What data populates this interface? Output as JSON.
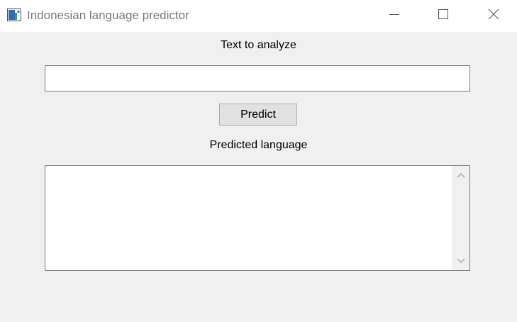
{
  "window": {
    "title": "Indonesian language predictor"
  },
  "icons": {
    "app": "app-window-icon",
    "minimize": "minimize-icon",
    "maximize": "maximize-icon",
    "close": "close-icon",
    "scroll_up": "chevron-up-icon",
    "scroll_down": "chevron-down-icon"
  },
  "input_section": {
    "label": "Text to analyze",
    "value": ""
  },
  "predict_button": {
    "label": "Predict"
  },
  "output_section": {
    "label": "Predicted language",
    "value": ""
  },
  "colors": {
    "window_background": "#f0f0f0",
    "titlebar_background": "#ffffff",
    "button_face": "#e1e1e1",
    "field_border": "#7a7a7a"
  }
}
